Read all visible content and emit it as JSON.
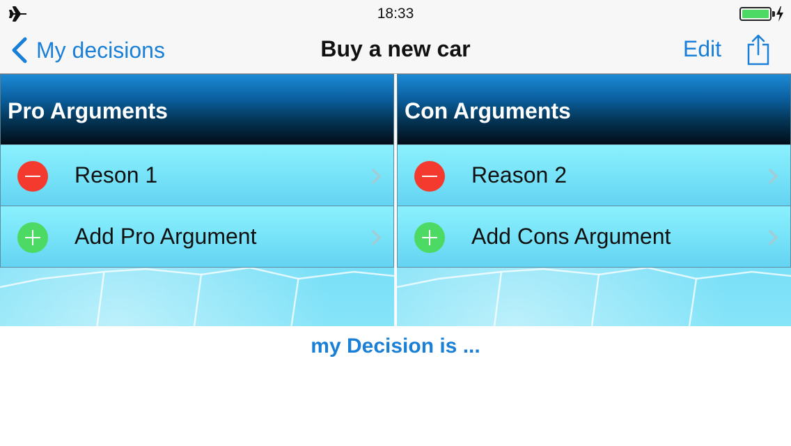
{
  "status_bar": {
    "time": "18:33",
    "airplane_icon": "airplane-icon",
    "battery_icon": "battery-full-icon",
    "charging_icon": "charging-bolt-icon",
    "battery_color": "#4cd964"
  },
  "nav": {
    "back_label": "My decisions",
    "title": "Buy a new car",
    "edit_label": "Edit",
    "share_icon": "share-icon",
    "tint_color": "#1a7fd6"
  },
  "pro": {
    "header": "Pro Arguments",
    "rows": [
      {
        "label": "Reson 1",
        "icon": "minus-circle-icon"
      },
      {
        "label": "Add Pro Argument",
        "icon": "plus-circle-icon"
      }
    ]
  },
  "con": {
    "header": "Con Arguments",
    "rows": [
      {
        "label": "Reason 2",
        "icon": "minus-circle-icon"
      },
      {
        "label": "Add Cons Argument",
        "icon": "plus-circle-icon"
      }
    ]
  },
  "decision_label": "my Decision is ...",
  "colors": {
    "delete": "#f43a2f",
    "add": "#4cd964",
    "row_background": "#76e2f8"
  }
}
